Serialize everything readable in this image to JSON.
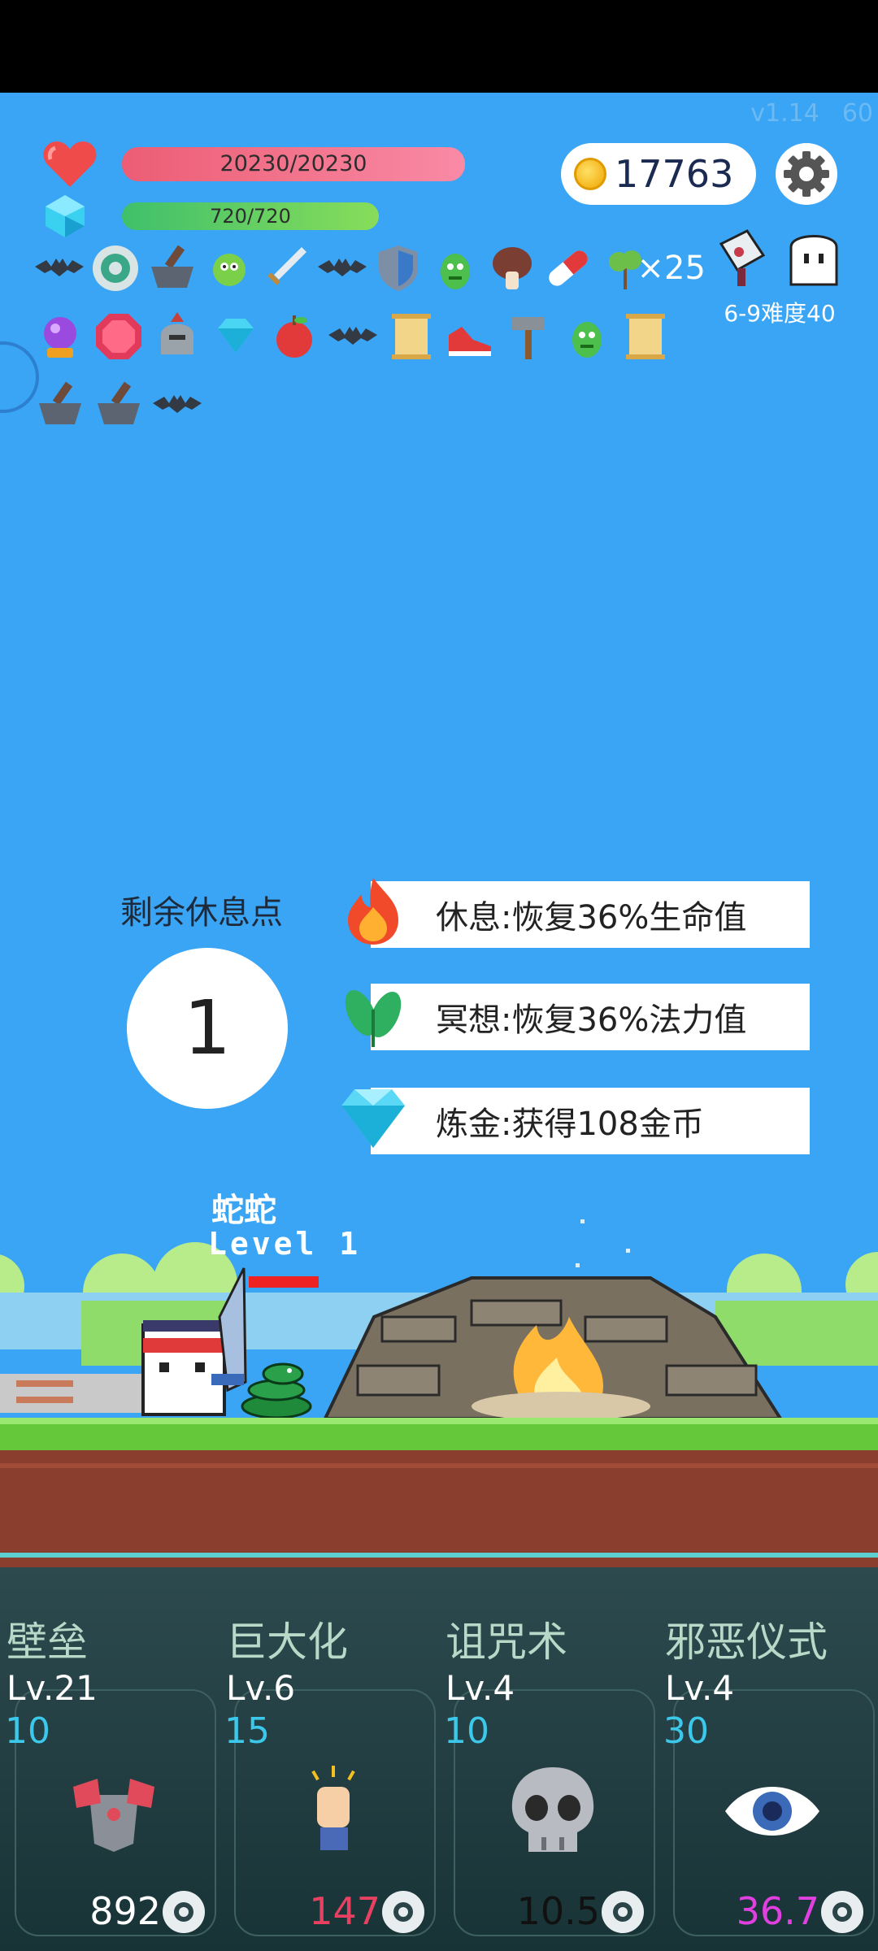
{
  "hud": {
    "version": "v1.14",
    "fps": "60",
    "hp_text": "20230/20230",
    "mp_text": "720/720",
    "coins": "17763",
    "bonus_count": "×25",
    "difficulty": "6-9难度40"
  },
  "inventory": {
    "row1": [
      "bat-icon",
      "disc-icon",
      "mortar-icon",
      "germ-icon",
      "sword-icon",
      "bat-icon",
      "shield-icon",
      "goblin-icon",
      "mushroom-icon",
      "pill-icon",
      "sapling-icon"
    ],
    "row2": [
      "crystal-ball-icon",
      "ruby-icon",
      "helmet-icon",
      "diamond-icon",
      "apple-icon",
      "bat-icon",
      "scroll-icon",
      "sneaker-icon",
      "hammer-icon",
      "goblin-icon",
      "scroll-icon"
    ],
    "row3": [
      "mortar-icon",
      "mortar-icon",
      "bat-icon"
    ]
  },
  "rest": {
    "label": "剩余休息点",
    "points": "1",
    "options": [
      {
        "label": "休息:恢复36%生命值",
        "icon": "fire-icon"
      },
      {
        "label": "冥想:恢复36%法力值",
        "icon": "leaf-icon"
      },
      {
        "label": "炼金:获得108金币",
        "icon": "diamond-icon"
      }
    ]
  },
  "enemy": {
    "name": "蛇蛇",
    "level": "Level 1"
  },
  "skills": [
    {
      "name": "壁垒",
      "level": "Lv.21",
      "cost": "10",
      "value": "892",
      "value_color": "#ffffff",
      "icon": "armor-icon"
    },
    {
      "name": "巨大化",
      "level": "Lv.6",
      "cost": "15",
      "value": "147",
      "value_color": "#e84060",
      "icon": "fist-icon"
    },
    {
      "name": "诅咒术",
      "level": "Lv.4",
      "cost": "10",
      "value": "10.5",
      "value_color": "#111111",
      "icon": "skull-icon"
    },
    {
      "name": "邪恶仪式",
      "level": "Lv.4",
      "cost": "30",
      "value": "36.7",
      "value_color": "#e040e0",
      "icon": "eye-icon"
    }
  ]
}
